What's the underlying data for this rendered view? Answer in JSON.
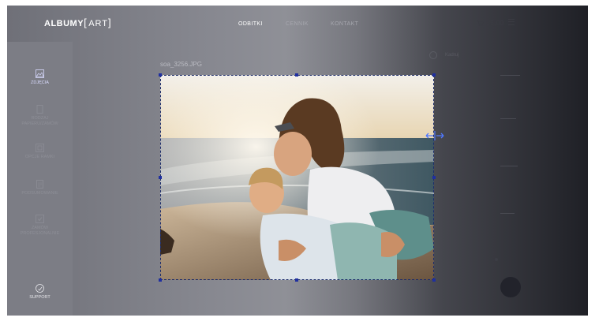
{
  "header": {
    "logo_main": "ALBUMY",
    "logo_bracket_open": "[",
    "logo_art": "ART",
    "logo_bracket_close": "]",
    "nav": [
      {
        "label": "ODBITKI",
        "active": true
      },
      {
        "label": "CENNIK",
        "active": false
      },
      {
        "label": "KONTAKT",
        "active": false
      }
    ],
    "price": "25,00",
    "icons": [
      "cart-icon",
      "menu-icon"
    ]
  },
  "sidebar": {
    "items": [
      {
        "label_lines": [
          "ZDJĘCIA"
        ],
        "icon": "image-icon",
        "active": true
      },
      {
        "label_lines": [
          "RODZAJ",
          "PAPIERU/ZAMÓW"
        ],
        "icon": "paper-icon",
        "active": false
      },
      {
        "label_lines": [
          "OPCJE RAMKI"
        ],
        "icon": "frame-icon",
        "active": false
      },
      {
        "label_lines": [
          "PODSUMOWANIE"
        ],
        "icon": "summary-icon",
        "active": false
      },
      {
        "label_lines": [
          "ZAMÓW",
          "PROFESJONALNIE"
        ],
        "icon": "order-icon",
        "active": false
      }
    ],
    "support_label": "SUPPORT",
    "support_icon": "support-icon"
  },
  "editor": {
    "filename": "soa_3256.JPG",
    "image_description": "mother-and-child-on-beach",
    "tool_icon": "resize-horizontal-icon"
  },
  "panel": {
    "toggle_label": "Kadruj"
  },
  "colors": {
    "accent": "#1f2fa0",
    "handle_arrow": "#4f78ff",
    "active_nav": "#ffffff",
    "sidebar_active": "#d9dbff"
  }
}
